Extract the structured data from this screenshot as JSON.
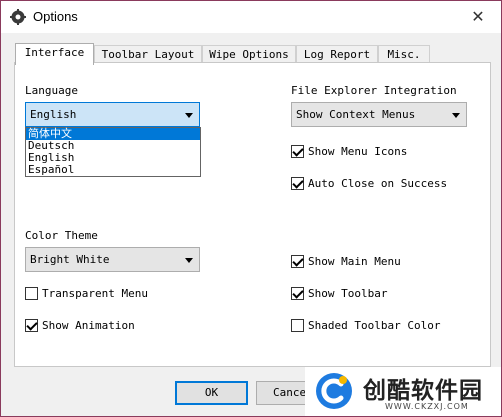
{
  "window": {
    "title": "Options",
    "close_glyph": "✕"
  },
  "tabs": [
    {
      "label": "Interface"
    },
    {
      "label": "Toolbar Layout"
    },
    {
      "label": "Wipe Options"
    },
    {
      "label": "Log Report"
    },
    {
      "label": "Misc."
    }
  ],
  "language": {
    "label": "Language",
    "value": "English",
    "options": [
      "简体中文",
      "Deutsch",
      "English",
      "Español"
    ],
    "highlighted": "简体中文"
  },
  "file_explorer": {
    "label": "File Explorer Integration",
    "value": "Show Context Menus",
    "show_menu_icons": {
      "label": "Show Menu Icons",
      "checked": true
    },
    "auto_close": {
      "label": "Auto Close on Success",
      "checked": true
    }
  },
  "color_theme": {
    "label": "Color Theme",
    "value": "Bright White"
  },
  "checks": {
    "transparent_menu": {
      "label": "Transparent Menu",
      "checked": false
    },
    "show_animation": {
      "label": "Show Animation",
      "checked": true
    },
    "show_main_menu": {
      "label": "Show Main Menu",
      "checked": true
    },
    "show_toolbar": {
      "label": "Show Toolbar",
      "checked": true
    },
    "shaded_toolbar": {
      "label": "Shaded Toolbar Color",
      "checked": false
    }
  },
  "buttons": {
    "ok": "OK",
    "cancel": "Cance"
  },
  "watermark": {
    "brand": "创酷软件园",
    "url": "WWW.CKZXJ.COM"
  }
}
